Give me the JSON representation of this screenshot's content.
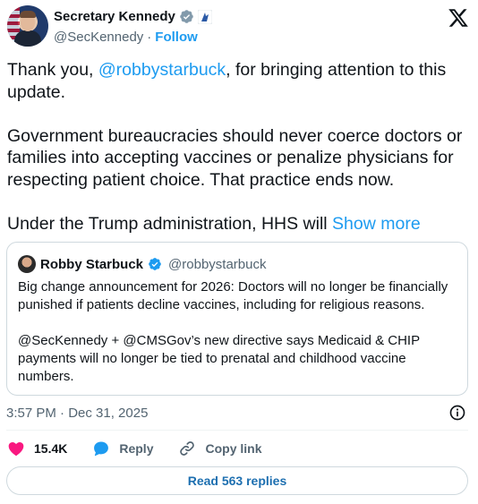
{
  "author": {
    "display_name": "Secretary Kennedy",
    "handle": "@SecKennedy",
    "separator": "·",
    "follow_label": "Follow"
  },
  "tweet": {
    "p1_prefix": "Thank you, ",
    "p1_mention": "@robbystarbuck",
    "p1_suffix": ", for bringing attention to this update.",
    "p2": "Government bureaucracies should never coerce doctors or families into accepting vaccines or penalize physicians for respecting patient choice. That practice ends now.",
    "p3": "Under the Trump administration, HHS will ",
    "show_more": "Show more"
  },
  "quote": {
    "name": "Robby Starbuck",
    "handle": "@robbystarbuck",
    "p1": "Big change announcement for 2026: Doctors will no longer be financially punished if patients decline vaccines, including for religious reasons.",
    "p2": "@SecKennedy + @CMSGov’s new directive says Medicaid & CHIP payments will no longer be tied to prenatal and childhood vaccine numbers."
  },
  "meta": {
    "timestamp": "3:57 PM · Dec 31, 2025"
  },
  "actions": {
    "likes": "15.4K",
    "reply": "Reply",
    "copy_link": "Copy link"
  },
  "read_replies": "Read 563 replies",
  "colors": {
    "accent": "#1d9bf0",
    "like": "#f91880",
    "text": "#0f1419",
    "muted": "#536471",
    "border": "#cfd9de"
  },
  "icons": [
    "verified-badge-icon",
    "government-badge-icon",
    "x-logo-icon",
    "info-icon",
    "heart-icon",
    "reply-icon",
    "link-icon"
  ]
}
